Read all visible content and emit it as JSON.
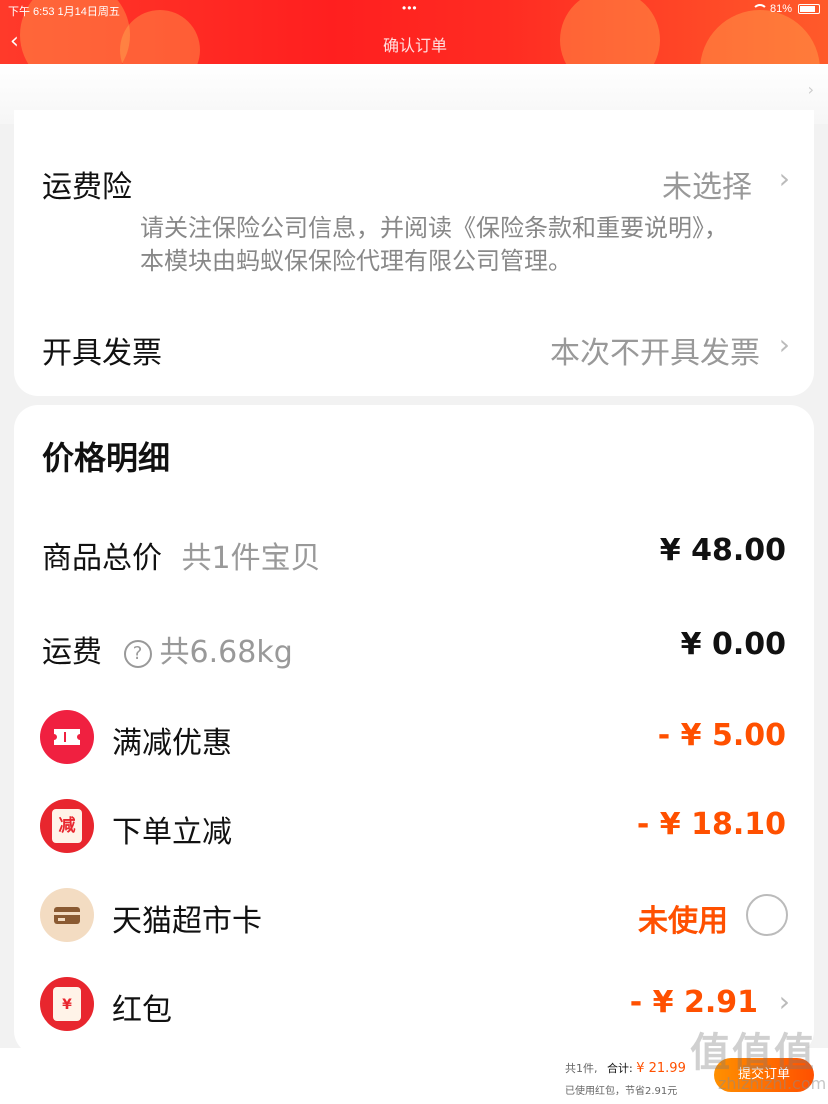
{
  "status_bar": {
    "time": "下午 6:53  1月14日周五",
    "dots": "•••",
    "battery": "81%"
  },
  "header": {
    "title": "确认订单"
  },
  "insurance": {
    "label": "运费险",
    "value": "未选择",
    "note": "请关注保险公司信息，并阅读《保险条款和重要说明》，本模块由蚂蚁保保险代理有限公司管理。"
  },
  "invoice": {
    "label": "开具发票",
    "value": "本次不开具发票"
  },
  "price_detail": {
    "title": "价格明细",
    "goods_total": {
      "label": "商品总价",
      "sub": "共1件宝贝",
      "value": "¥ 48.00"
    },
    "shipping": {
      "label": "运费",
      "sub": "共6.68kg",
      "value": "¥ 0.00"
    },
    "full_discount": {
      "label": "满减优惠",
      "value": "- ¥ 5.00"
    },
    "order_discount": {
      "label": "下单立减",
      "icon_text": "减",
      "value": "- ¥ 18.10"
    },
    "tmall_card": {
      "label": "天猫超市卡",
      "value": "未使用"
    },
    "red_packet": {
      "label": "红包",
      "icon_text": "¥",
      "value": "- ¥ 2.91"
    }
  },
  "bottom_bar": {
    "count": "共1件,",
    "total_label": "合计:",
    "total_value": "¥ 21.99",
    "used_info": "已使用红包，节省2.91元",
    "submit": "提交订单"
  },
  "watermark": {
    "main": "值值值",
    "sub": "zhizhizhi.com"
  },
  "colors": {
    "accent_red": "#ff2222",
    "orange": "#ff5000",
    "muted": "#999999"
  }
}
